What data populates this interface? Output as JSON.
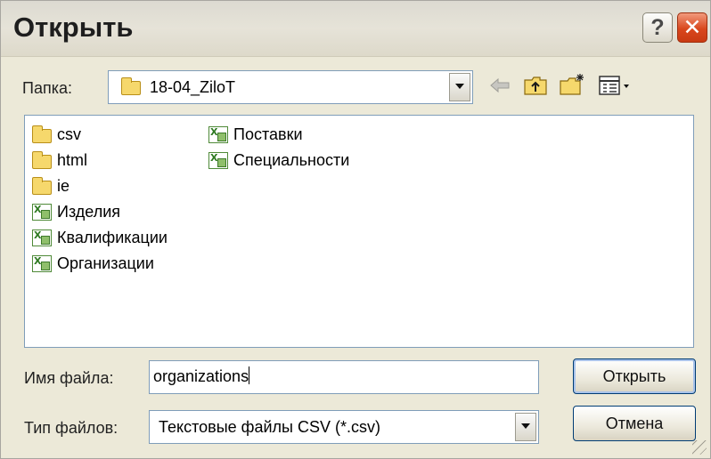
{
  "window": {
    "title": "Открыть"
  },
  "folder_bar": {
    "label": "Папка:",
    "current_folder": "18-04_ZiloT"
  },
  "files": [
    {
      "name": "csv",
      "type": "folder"
    },
    {
      "name": "html",
      "type": "folder"
    },
    {
      "name": "ie",
      "type": "folder"
    },
    {
      "name": "Изделия",
      "type": "excel"
    },
    {
      "name": "Квалификации",
      "type": "excel"
    },
    {
      "name": "Организации",
      "type": "excel"
    },
    {
      "name": "Поставки",
      "type": "excel"
    },
    {
      "name": "Специальности",
      "type": "excel"
    }
  ],
  "filename": {
    "label": "Имя файла:",
    "value": "organizations"
  },
  "filetype": {
    "label": "Тип файлов:",
    "value": "Текстовые файлы CSV (*.csv)"
  },
  "buttons": {
    "open": "Открыть",
    "cancel": "Отмена"
  },
  "colors": {
    "title_bg": "#e0ddd2",
    "close_red": "#d9471d",
    "dialog_bg": "#ece9d8",
    "border_blue": "#7f9db9"
  }
}
